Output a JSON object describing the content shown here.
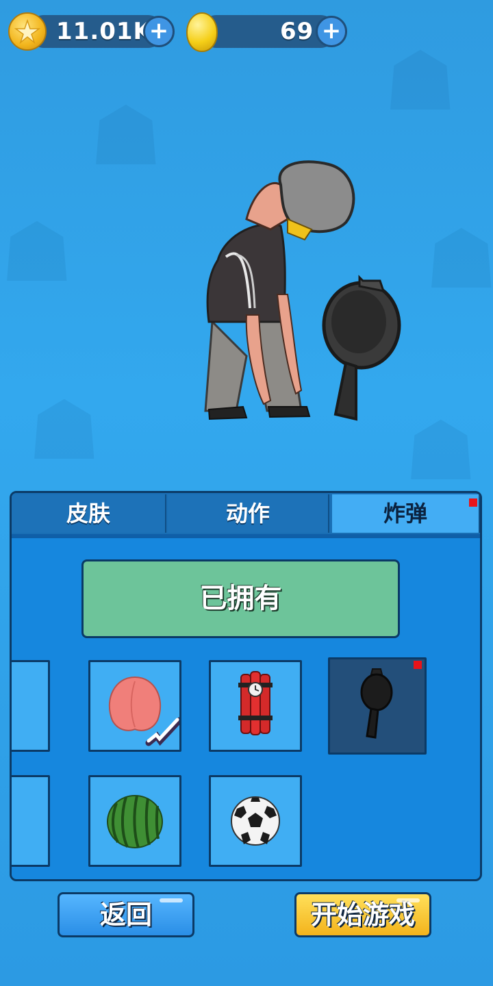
{
  "currency": {
    "coins_value": "11.01K",
    "gems_value": "69",
    "plus_symbol": "+"
  },
  "tabs": [
    {
      "label": "皮肤",
      "active": false
    },
    {
      "label": "动作",
      "active": false
    },
    {
      "label": "炸弹",
      "active": true
    }
  ],
  "status_button": {
    "label": "已拥有"
  },
  "items": [
    {
      "icon": "peach-icon",
      "checked": true
    },
    {
      "icon": "dynamite-icon"
    },
    {
      "icon": "frying-pan-icon",
      "selected": true
    },
    {
      "icon": "watermelon-icon"
    },
    {
      "icon": "soccer-ball-icon"
    }
  ],
  "buttons": {
    "back_label": "返回",
    "start_label": "开始游戏"
  },
  "colors": {
    "background": "#33a8ee",
    "panel": "#1687de",
    "owned": "#6dc49a",
    "start": "#f5c23a",
    "back": "#3a9ff0"
  }
}
